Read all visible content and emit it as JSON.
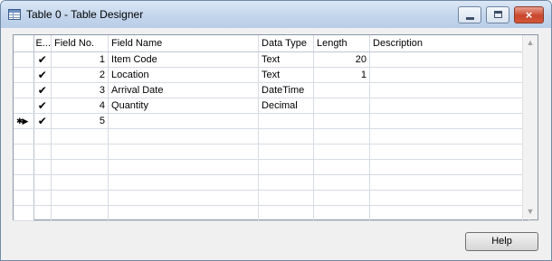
{
  "window": {
    "title": "Table 0 - Table Designer",
    "close_glyph": "×"
  },
  "grid": {
    "columns": [
      "E...",
      "Field No.",
      "Field Name",
      "Data Type",
      "Length",
      "Description"
    ],
    "rows": [
      {
        "enabled": "✔",
        "field_no": "1",
        "field_name": "Item Code",
        "data_type": "Text",
        "length": "20",
        "description": ""
      },
      {
        "enabled": "✔",
        "field_no": "2",
        "field_name": "Location",
        "data_type": "Text",
        "length": "1",
        "description": ""
      },
      {
        "enabled": "✔",
        "field_no": "3",
        "field_name": "Arrival Date",
        "data_type": "DateTime",
        "length": "",
        "description": ""
      },
      {
        "enabled": "✔",
        "field_no": "4",
        "field_name": "Quantity",
        "data_type": "Decimal",
        "length": "",
        "description": ""
      },
      {
        "enabled": "✔",
        "field_no": "5",
        "field_name": "",
        "data_type": "",
        "length": "",
        "description": "",
        "new_row_marker": "✱▶"
      }
    ],
    "empty_rows": 6
  },
  "buttons": {
    "help_label": "Help"
  },
  "icons": {
    "app": "table-icon",
    "minimize": "minimize-icon",
    "maximize": "maximize-icon",
    "close": "close-icon",
    "scroll_up": "scroll-up-arrow-icon",
    "scroll_down": "scroll-down-arrow-icon",
    "check": "checkmark-icon"
  }
}
